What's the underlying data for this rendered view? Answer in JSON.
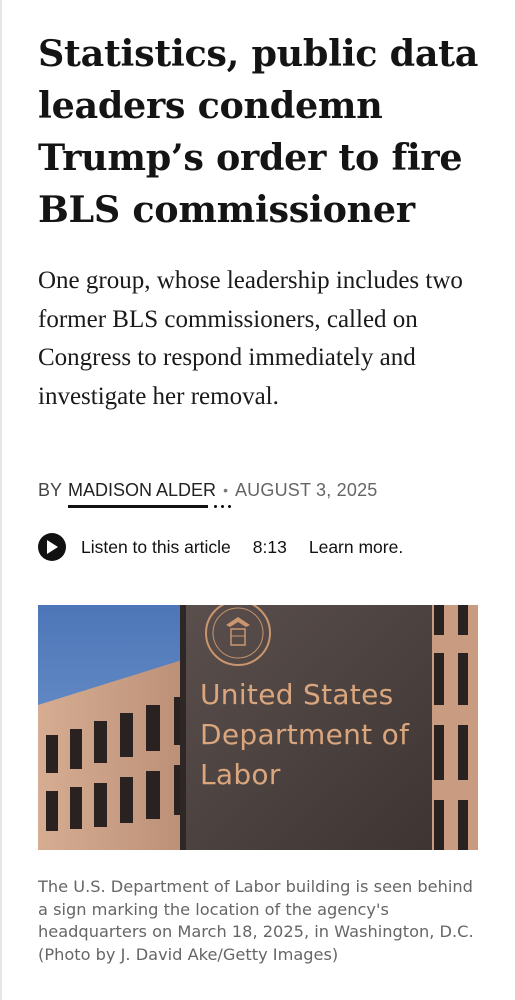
{
  "article": {
    "headline": "Statistics, public data leaders condemn Trump’s order to fire BLS commissioner",
    "dek": "One group, whose leadership includes two former BLS commissioners, called on Congress to respond immediately and investigate her removal.",
    "byline": {
      "prefix": "BY",
      "author": "MADISON ALDER",
      "separator": "•",
      "date": "AUGUST 3, 2025"
    },
    "audio": {
      "icon": "play-icon",
      "listen_label": "Listen to this article",
      "duration": "8:13",
      "learn_more": "Learn more."
    },
    "photo": {
      "sign_text": "United States Department of Labor",
      "caption": "The U.S. Department of Labor building is seen behind a sign marking the location of the agency's headquarters on March 18, 2025, in Washington, D.C. (Photo by J. David Ake/Getty Images)"
    }
  },
  "colors": {
    "sign_background": "#4f4543",
    "sign_text": "#d9a67e",
    "sky": "#5a7fb5",
    "building": "#c8a08a"
  }
}
